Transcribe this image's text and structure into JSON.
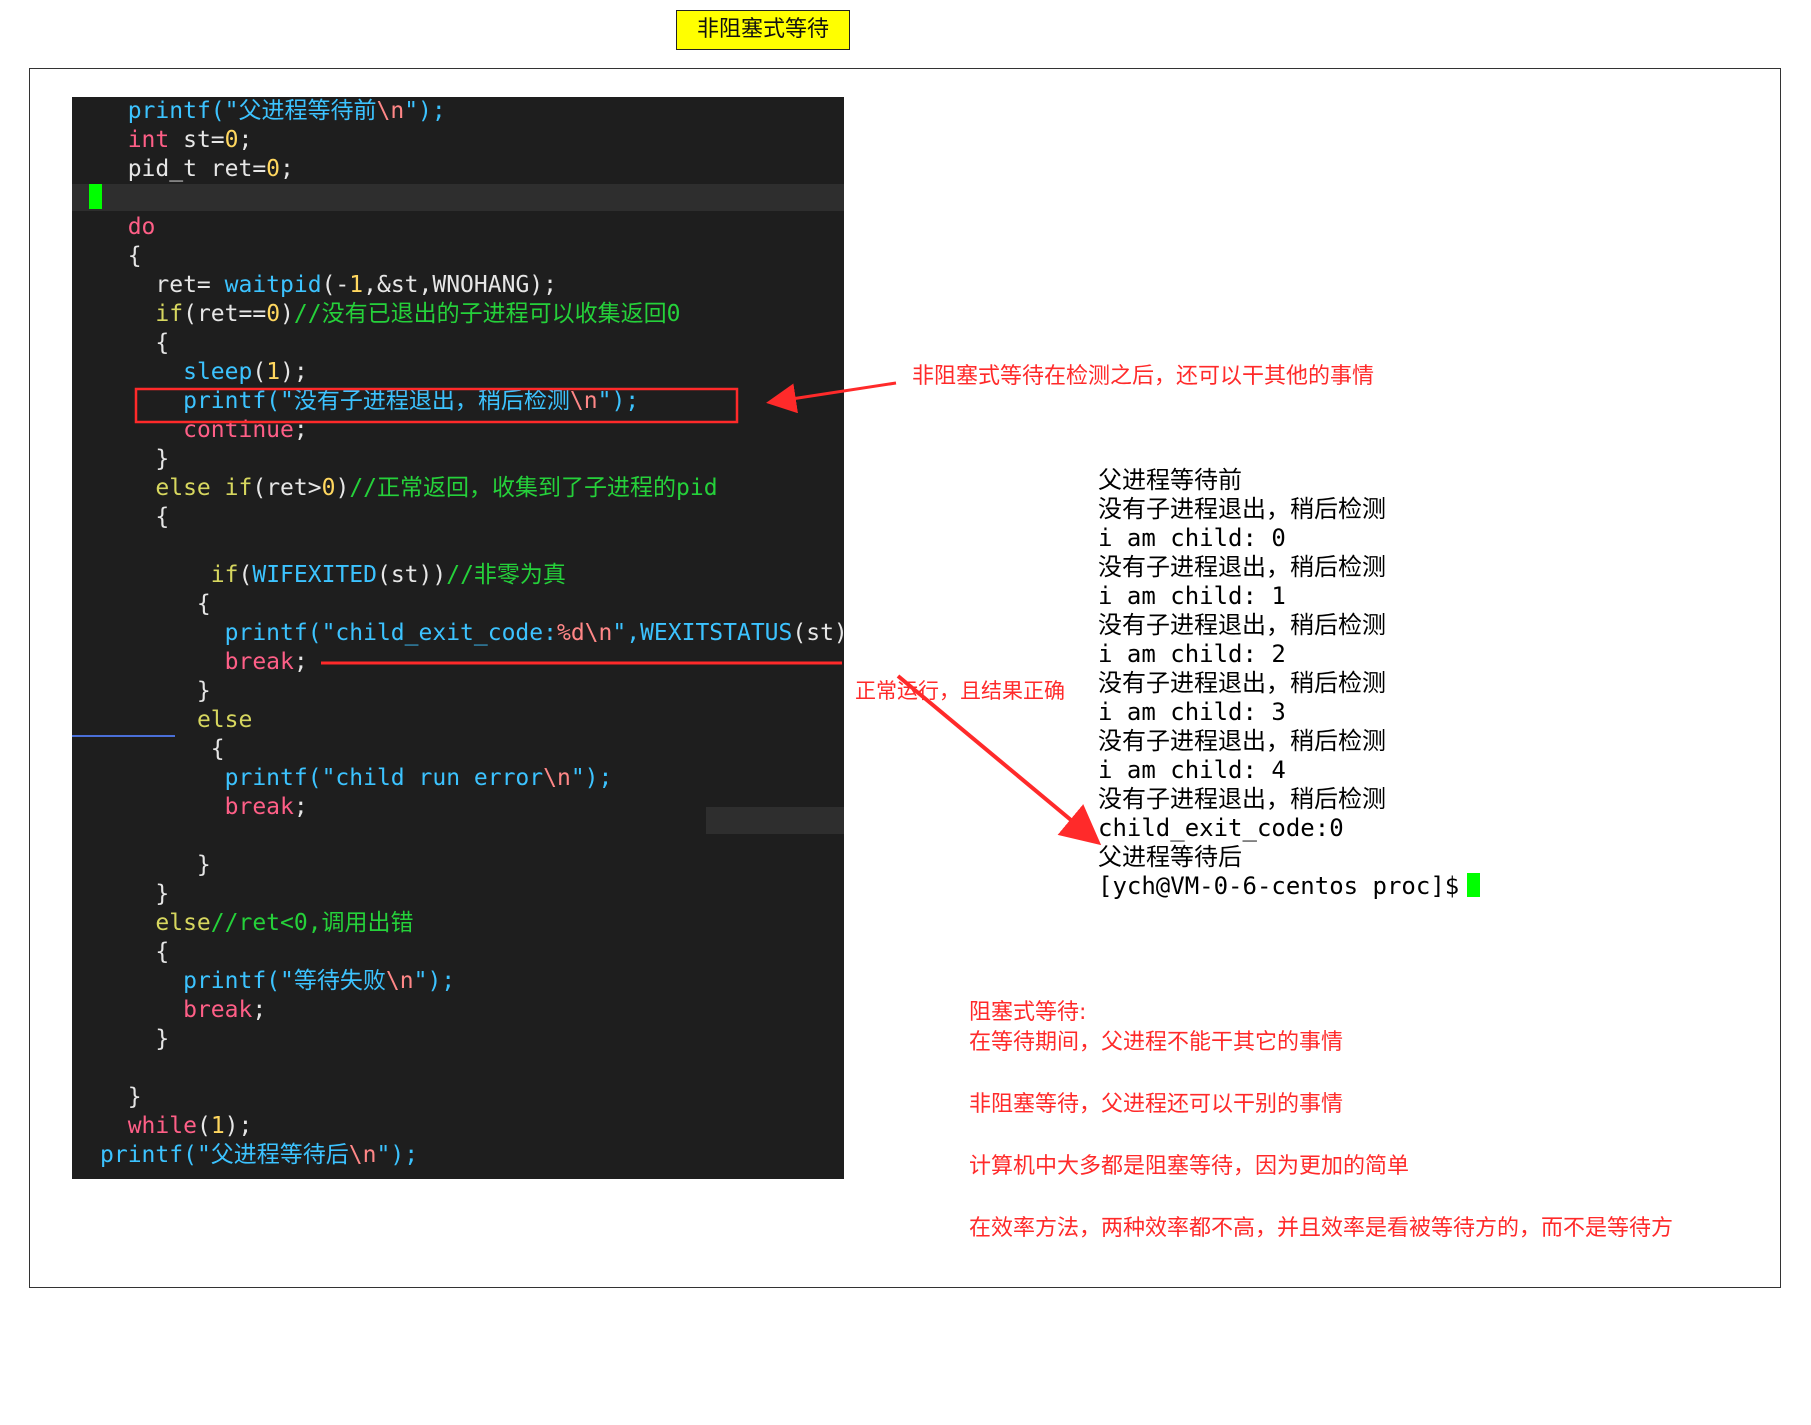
{
  "title_tag": "非阻塞式等待",
  "code_lines": [
    [
      {
        "t": "  ",
        "c": "plain"
      },
      {
        "t": "printf",
        "c": "fn"
      },
      {
        "t": "(\"父进程等待前",
        "c": "str"
      },
      {
        "t": "\\n",
        "c": "esc"
      },
      {
        "t": "\");",
        "c": "str"
      }
    ],
    [
      {
        "t": "  ",
        "c": "plain"
      },
      {
        "t": "int",
        "c": "kw"
      },
      {
        "t": " st=",
        "c": "plain"
      },
      {
        "t": "0",
        "c": "num"
      },
      {
        "t": ";",
        "c": "plain"
      }
    ],
    [
      {
        "t": "  pid_t ret=",
        "c": "plain"
      },
      {
        "t": "0",
        "c": "num"
      },
      {
        "t": ";",
        "c": "plain"
      }
    ],
    [
      {
        "t": "",
        "c": "plain"
      }
    ],
    [
      {
        "t": "  ",
        "c": "plain"
      },
      {
        "t": "do",
        "c": "kw"
      }
    ],
    [
      {
        "t": "  {",
        "c": "plain"
      }
    ],
    [
      {
        "t": "    ret= ",
        "c": "plain"
      },
      {
        "t": "waitpid",
        "c": "fn"
      },
      {
        "t": "(-",
        "c": "plain"
      },
      {
        "t": "1",
        "c": "num"
      },
      {
        "t": ",&st,WNOHANG);",
        "c": "plain"
      }
    ],
    [
      {
        "t": "    ",
        "c": "plain"
      },
      {
        "t": "if",
        "c": "kw2"
      },
      {
        "t": "(ret==",
        "c": "plain"
      },
      {
        "t": "0",
        "c": "num"
      },
      {
        "t": ")",
        "c": "plain"
      },
      {
        "t": "//没有已退出的子进程可以收集返回0",
        "c": "com"
      }
    ],
    [
      {
        "t": "    {",
        "c": "plain"
      }
    ],
    [
      {
        "t": "      ",
        "c": "plain"
      },
      {
        "t": "sleep",
        "c": "fn"
      },
      {
        "t": "(",
        "c": "plain"
      },
      {
        "t": "1",
        "c": "num"
      },
      {
        "t": ");",
        "c": "plain"
      }
    ],
    [
      {
        "t": "      ",
        "c": "plain"
      },
      {
        "t": "printf",
        "c": "fn"
      },
      {
        "t": "(\"没有子进程退出，稍后检测",
        "c": "str"
      },
      {
        "t": "\\n",
        "c": "esc"
      },
      {
        "t": "\");",
        "c": "str"
      }
    ],
    [
      {
        "t": "      ",
        "c": "plain"
      },
      {
        "t": "continue",
        "c": "kw"
      },
      {
        "t": ";",
        "c": "plain"
      }
    ],
    [
      {
        "t": "    }",
        "c": "plain"
      }
    ],
    [
      {
        "t": "    ",
        "c": "plain"
      },
      {
        "t": "else",
        "c": "kw2"
      },
      {
        "t": " ",
        "c": "plain"
      },
      {
        "t": "if",
        "c": "kw2"
      },
      {
        "t": "(ret>",
        "c": "plain"
      },
      {
        "t": "0",
        "c": "num"
      },
      {
        "t": ")",
        "c": "plain"
      },
      {
        "t": "//正常返回，收集到了子进程的pid",
        "c": "com"
      }
    ],
    [
      {
        "t": "    {",
        "c": "plain"
      }
    ],
    [
      {
        "t": "",
        "c": "plain"
      }
    ],
    [
      {
        "t": "        ",
        "c": "plain"
      },
      {
        "t": "if",
        "c": "kw2"
      },
      {
        "t": "(",
        "c": "plain"
      },
      {
        "t": "WIFEXITED",
        "c": "mac"
      },
      {
        "t": "(st))",
        "c": "plain"
      },
      {
        "t": "//非零为真",
        "c": "com"
      }
    ],
    [
      {
        "t": "       {",
        "c": "plain"
      }
    ],
    [
      {
        "t": "         ",
        "c": "plain"
      },
      {
        "t": "printf",
        "c": "fn"
      },
      {
        "t": "(\"child_exit_code:",
        "c": "str"
      },
      {
        "t": "%d\\n",
        "c": "esc"
      },
      {
        "t": "\",",
        "c": "str"
      },
      {
        "t": "WEXITSTATUS",
        "c": "mac"
      },
      {
        "t": "(st));",
        "c": "plain"
      }
    ],
    [
      {
        "t": "         ",
        "c": "plain"
      },
      {
        "t": "break",
        "c": "kw"
      },
      {
        "t": ";",
        "c": "plain"
      }
    ],
    [
      {
        "t": "       }",
        "c": "plain"
      }
    ],
    [
      {
        "t": "       ",
        "c": "plain"
      },
      {
        "t": "else",
        "c": "kw2"
      }
    ],
    [
      {
        "t": "        {",
        "c": "plain"
      }
    ],
    [
      {
        "t": "         ",
        "c": "plain"
      },
      {
        "t": "printf",
        "c": "fn"
      },
      {
        "t": "(\"child run error",
        "c": "str"
      },
      {
        "t": "\\n",
        "c": "esc"
      },
      {
        "t": "\");",
        "c": "str"
      }
    ],
    [
      {
        "t": "         ",
        "c": "plain"
      },
      {
        "t": "break",
        "c": "kw"
      },
      {
        "t": ";",
        "c": "plain"
      }
    ],
    [
      {
        "t": "",
        "c": "plain"
      }
    ],
    [
      {
        "t": "       }",
        "c": "plain"
      }
    ],
    [
      {
        "t": "    }",
        "c": "plain"
      }
    ],
    [
      {
        "t": "    ",
        "c": "plain"
      },
      {
        "t": "else",
        "c": "kw2"
      },
      {
        "t": "//ret<0,调用出错",
        "c": "com"
      }
    ],
    [
      {
        "t": "    {",
        "c": "plain"
      }
    ],
    [
      {
        "t": "      ",
        "c": "plain"
      },
      {
        "t": "printf",
        "c": "fn"
      },
      {
        "t": "(\"等待失败",
        "c": "str"
      },
      {
        "t": "\\n",
        "c": "esc"
      },
      {
        "t": "\");",
        "c": "str"
      }
    ],
    [
      {
        "t": "      ",
        "c": "plain"
      },
      {
        "t": "break",
        "c": "kw"
      },
      {
        "t": ";",
        "c": "plain"
      }
    ],
    [
      {
        "t": "    }",
        "c": "plain"
      }
    ],
    [
      {
        "t": "",
        "c": "plain"
      }
    ],
    [
      {
        "t": "  }",
        "c": "plain"
      }
    ],
    [
      {
        "t": "  ",
        "c": "plain"
      },
      {
        "t": "while",
        "c": "kw"
      },
      {
        "t": "(",
        "c": "plain"
      },
      {
        "t": "1",
        "c": "num"
      },
      {
        "t": ");",
        "c": "plain"
      }
    ],
    [
      {
        "t": "printf",
        "c": "fn"
      },
      {
        "t": "(\"父进程等待后",
        "c": "str"
      },
      {
        "t": "\\n",
        "c": "esc"
      },
      {
        "t": "\");",
        "c": "str"
      }
    ]
  ],
  "terminal_lines": [
    "父进程等待前",
    "没有子进程退出，稍后检测",
    "i am child: 0",
    "没有子进程退出，稍后检测",
    "i am child: 1",
    "没有子进程退出，稍后检测",
    "i am child: 2",
    "没有子进程退出，稍后检测",
    "i am child: 3",
    "没有子进程退出，稍后检测",
    "i am child: 4",
    "没有子进程退出，稍后检测",
    "child_exit_code:0",
    "父进程等待后"
  ],
  "terminal_prompt": "[ych@VM-0-6-centos proc]$",
  "annotations": {
    "non_blocking_note": "非阻塞式等待在检测之后，还可以干其他的事情",
    "correct_run_note": "正常运行，且结果正确",
    "summary": [
      "阻塞式等待:",
      "在等待期间，父进程不能干其它的事情",
      "非阻塞等待，父进程还可以干别的事情",
      "计算机中大多都是阻塞等待，因为更加的简单",
      "在效率方法，两种效率都不高，并且效率是看被等待方的，而不是等待方"
    ]
  },
  "colors": {
    "annotation_red": "#ff2a2a",
    "title_bg": "#ffff00",
    "editor_bg": "#1e1e1e",
    "cursor": "#00ff00"
  }
}
